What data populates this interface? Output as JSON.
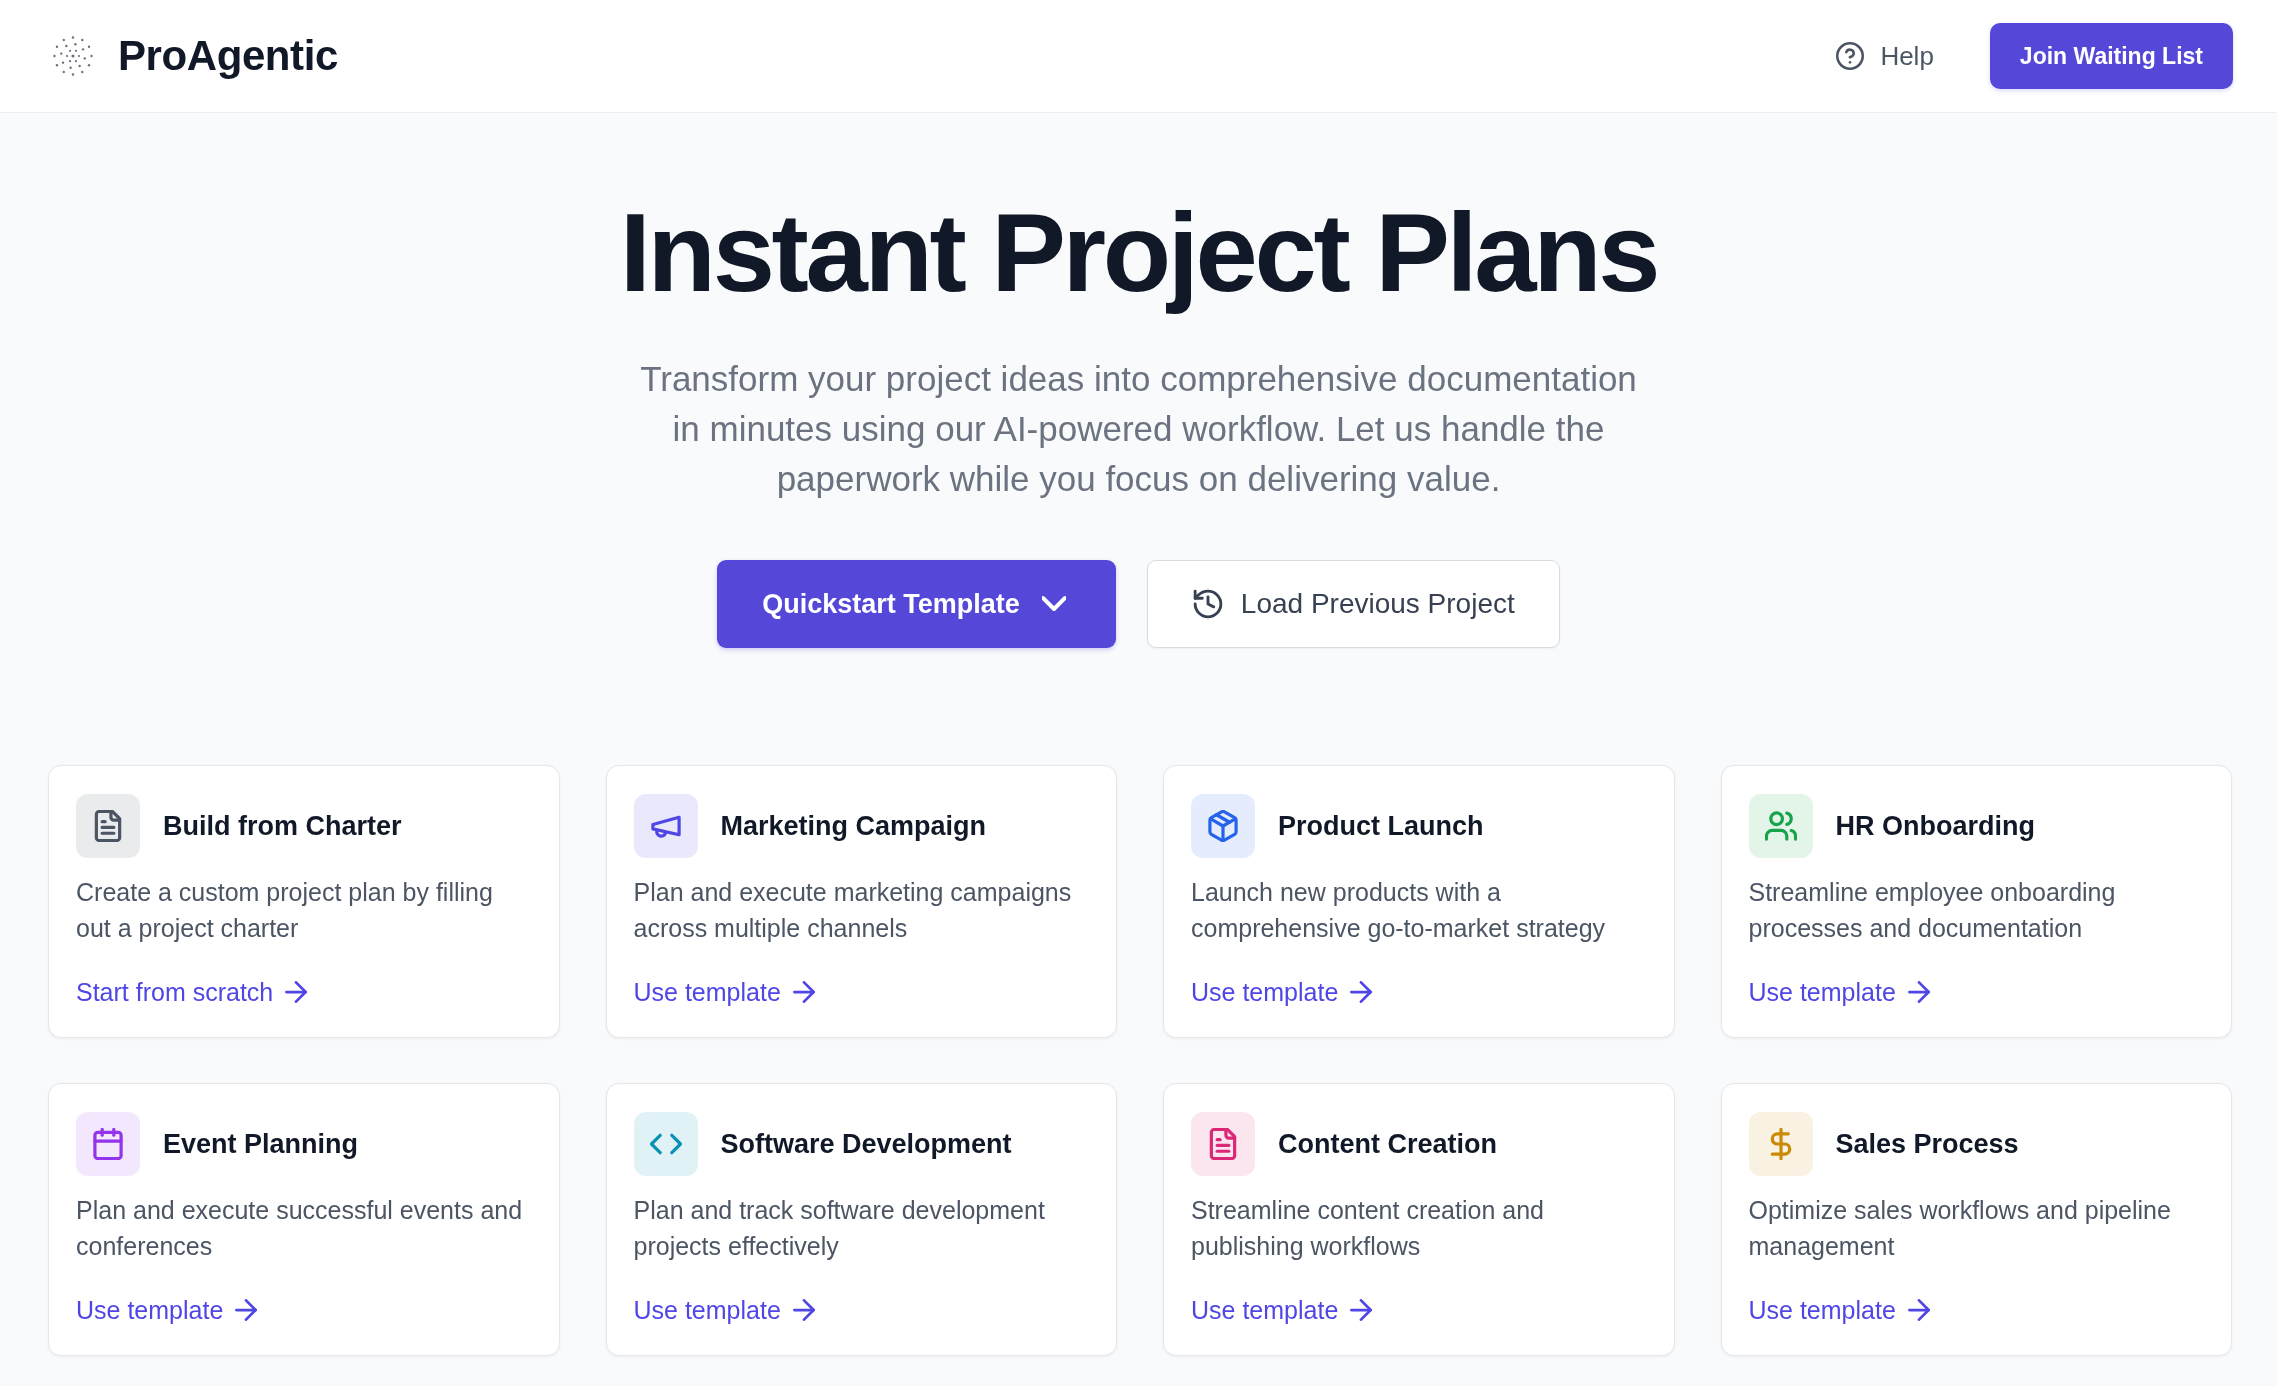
{
  "header": {
    "brand": "ProAgentic",
    "help": "Help",
    "cta": "Join Waiting List"
  },
  "hero": {
    "title": "Instant Project Plans",
    "subtitle": "Transform your project ideas into comprehensive documentation in minutes using our AI-powered workflow. Let us handle the paperwork while you focus on delivering value.",
    "buttons": [
      {
        "label": "Quickstart Template",
        "kind": "primary"
      },
      {
        "label": "Load Previous Project",
        "kind": "secondary"
      }
    ]
  },
  "cards": [
    {
      "title": "Build from Charter",
      "description": "Create a custom project plan by filling out a project charter",
      "link": "Start from scratch",
      "color": "#4b5563"
    },
    {
      "title": "Marketing Campaign",
      "description": "Plan and execute marketing campaigns across multiple channels",
      "link": "Use template",
      "color": "#4f46e5"
    },
    {
      "title": "Product Launch",
      "description": "Launch new products with a comprehensive go-to-market strategy",
      "link": "Use template",
      "color": "#2563eb"
    },
    {
      "title": "HR Onboarding",
      "description": "Streamline employee onboarding processes and documentation",
      "link": "Use template",
      "color": "#16a34a"
    },
    {
      "title": "Event Planning",
      "description": "Plan and execute successful events and conferences",
      "link": "Use template",
      "color": "#9333ea"
    },
    {
      "title": "Software Development",
      "description": "Plan and track software development projects effectively",
      "link": "Use template",
      "color": "#0891b2"
    },
    {
      "title": "Content Creation",
      "description": "Streamline content creation and publishing workflows",
      "link": "Use template",
      "color": "#db2777"
    },
    {
      "title": "Sales Process",
      "description": "Optimize sales workflows and pipeline management",
      "link": "Use template",
      "color": "#ca8a04"
    }
  ]
}
